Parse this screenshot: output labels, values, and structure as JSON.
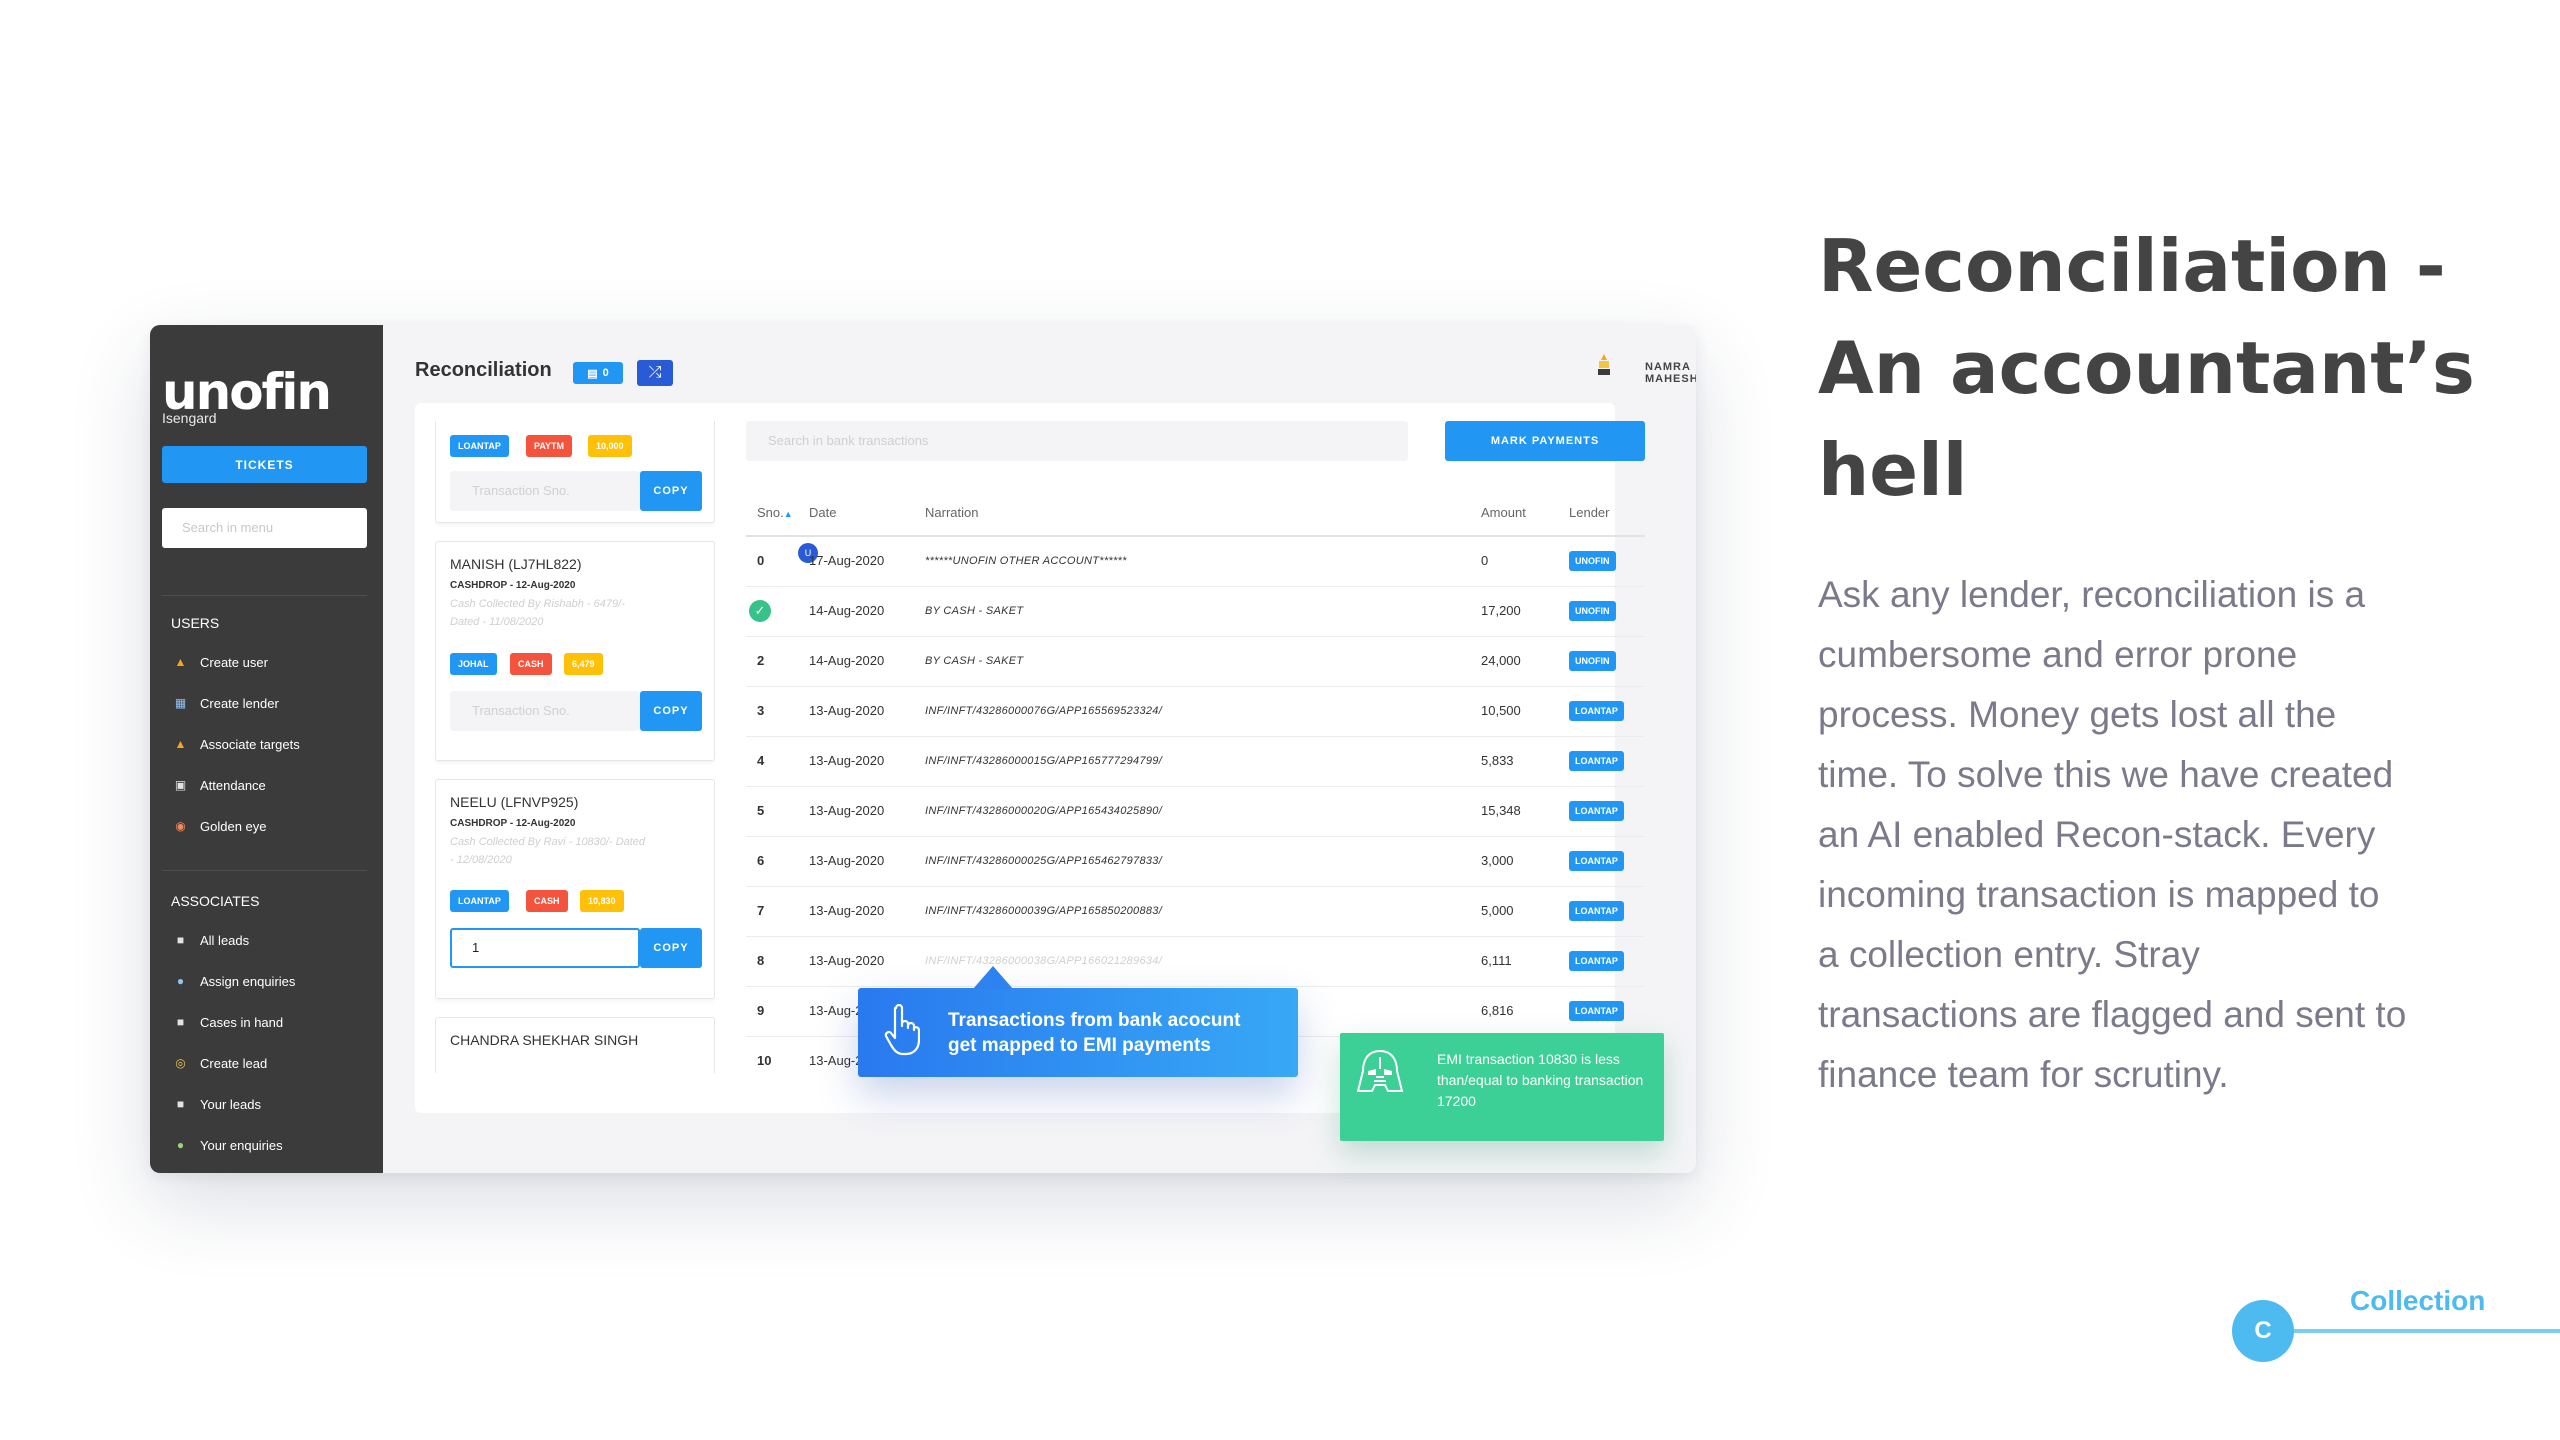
{
  "sidebar": {
    "logo": "unofin",
    "logo_sub": "Isengard",
    "tickets_label": "TICKETS",
    "search_placeholder": "Search in menu",
    "users_title": "USERS",
    "users_items": [
      {
        "label": "Create user",
        "icon": "person-icon"
      },
      {
        "label": "Create lender",
        "icon": "bank-icon"
      },
      {
        "label": "Associate targets",
        "icon": "person-icon"
      },
      {
        "label": "Attendance",
        "icon": "calendar-icon"
      },
      {
        "label": "Golden eye",
        "icon": "eye-icon"
      }
    ],
    "associates_title": "ASSOCIATES",
    "associates_items": [
      {
        "label": "All leads",
        "icon": "car-icon"
      },
      {
        "label": "Assign enquiries",
        "icon": "people-icon"
      },
      {
        "label": "Cases in hand",
        "icon": "car-icon"
      },
      {
        "label": "Create lead",
        "icon": "target-icon"
      },
      {
        "label": "Your leads",
        "icon": "car-icon"
      },
      {
        "label": "Your enquiries",
        "icon": "globe-icon"
      }
    ]
  },
  "header": {
    "title": "Reconciliation",
    "badge_count": "0",
    "user_name": "NAMRA MAHESHWARI"
  },
  "entries": [
    {
      "tags": [
        {
          "text": "LOANTAP",
          "color": "#2196f3"
        },
        {
          "text": "PAYTM",
          "color": "#f4533d"
        },
        {
          "text": "10,000",
          "color": "#ffc107"
        }
      ],
      "input_placeholder": "Transaction Sno.",
      "copy_label": "COPY"
    },
    {
      "name": "MANISH (LJ7HL822)",
      "sub": "CASHDROP - 12-Aug-2020",
      "note1": "Cash Collected By Rishabh - 6479/-",
      "note2": "Dated - 11/08/2020",
      "tags": [
        {
          "text": "JOHAL",
          "color": "#2196f3"
        },
        {
          "text": "CASH",
          "color": "#f4533d"
        },
        {
          "text": "6,479",
          "color": "#ffc107"
        }
      ],
      "input_placeholder": "Transaction Sno.",
      "copy_label": "COPY"
    },
    {
      "name": "NEELU (LFNVP925)",
      "sub": "CASHDROP - 12-Aug-2020",
      "note1": "Cash Collected By Ravi - 10830/- Dated",
      "note2": "- 12/08/2020",
      "tags": [
        {
          "text": "LOANTAP",
          "color": "#2196f3"
        },
        {
          "text": "CASH",
          "color": "#f4533d"
        },
        {
          "text": "10,830",
          "color": "#ffc107"
        }
      ],
      "input_value": "1",
      "copy_label": "COPY"
    },
    {
      "name": "CHANDRA SHEKHAR SINGH"
    }
  ],
  "bank": {
    "search_placeholder": "Search in bank transactions",
    "mark_label": "MARK PAYMENTS",
    "columns": [
      "Sno.",
      "Date",
      "Narration",
      "Amount",
      "Lender"
    ],
    "rows": [
      {
        "sno": "0",
        "date": "17-Aug-2020",
        "narration": "******UNOFIN OTHER ACCOUNT******",
        "amount": "0",
        "lender": "UNOFIN"
      },
      {
        "sno": "",
        "date": "14-Aug-2020",
        "narration": "BY CASH - SAKET",
        "amount": "17,200",
        "lender": "UNOFIN"
      },
      {
        "sno": "2",
        "date": "14-Aug-2020",
        "narration": "BY CASH - SAKET",
        "amount": "24,000",
        "lender": "UNOFIN"
      },
      {
        "sno": "3",
        "date": "13-Aug-2020",
        "narration": "INF/INFT/43286000076G/APP165569523324/",
        "amount": "10,500",
        "lender": "LOANTAP"
      },
      {
        "sno": "4",
        "date": "13-Aug-2020",
        "narration": "INF/INFT/43286000015G/APP165777294799/",
        "amount": "5,833",
        "lender": "LOANTAP"
      },
      {
        "sno": "5",
        "date": "13-Aug-2020",
        "narration": "INF/INFT/43286000020G/APP165434025890/",
        "amount": "15,348",
        "lender": "LOANTAP"
      },
      {
        "sno": "6",
        "date": "13-Aug-2020",
        "narration": "INF/INFT/43286000025G/APP165462797833/",
        "amount": "3,000",
        "lender": "LOANTAP"
      },
      {
        "sno": "7",
        "date": "13-Aug-2020",
        "narration": "INF/INFT/43286000039G/APP165850200883/",
        "amount": "5,000",
        "lender": "LOANTAP"
      },
      {
        "sno": "8",
        "date": "13-Aug-2020",
        "narration": "INF/INFT/43286000038G/APP166021289634/",
        "amount": "6,111",
        "lender": "LOANTAP"
      },
      {
        "sno": "9",
        "date": "13-Aug-2020",
        "narration": "",
        "amount": "6,816",
        "lender": "LOANTAP"
      },
      {
        "sno": "10",
        "date": "13-Aug-2020",
        "narration": "",
        "amount": "",
        "lender": ""
      }
    ],
    "u_badge": "U"
  },
  "callouts": {
    "blue_line1": "Transactions from bank acocunt",
    "blue_line2": "get mapped to EMI payments",
    "green_text": "EMI transaction 10830 is less than/equal to banking transaction 17200"
  },
  "slide": {
    "headline": [
      "Reconciliation -",
      "An accountant’s",
      "hell"
    ],
    "body": "Ask any lender, reconciliation is a cumbersome and error prone process. Money gets lost all the time. To solve this we have created an AI enabled Recon-stack. Every incoming transaction is mapped to a collection entry. Stray transactions are flagged and sent to finance team for scrutiny.",
    "section_label": "Collection",
    "section_letter": "C"
  },
  "colors": {
    "accent": "#2196f3",
    "sidebar": "#3b3b3b",
    "success": "#3ccf96",
    "heading": "#444444"
  }
}
